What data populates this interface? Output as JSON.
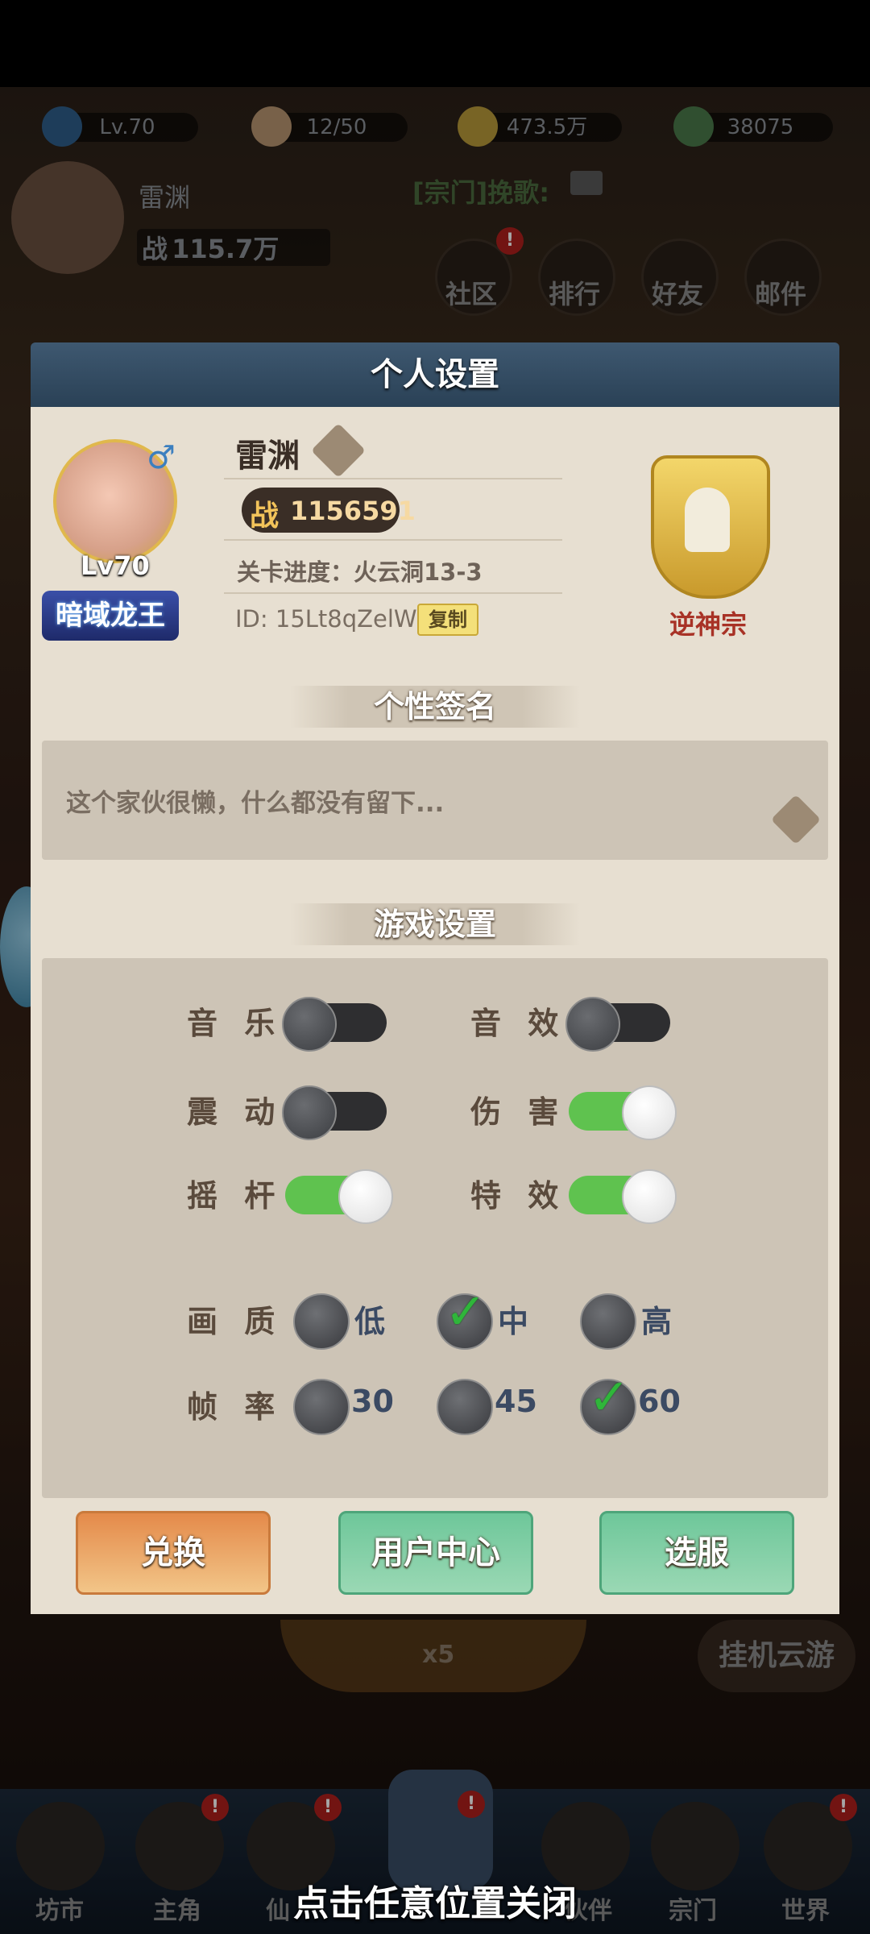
{
  "top_bar": {
    "level": "Lv.70",
    "stamina": "12/50",
    "coins": "473.5万",
    "gems": "38075",
    "player_name": "雷渊",
    "power_label": "战",
    "power_value": "115.7万",
    "sect_chat": "[宗门]挽歌:",
    "menu": [
      {
        "label": "社区",
        "badge": "!"
      },
      {
        "label": "排行",
        "badge": ""
      },
      {
        "label": "好友",
        "badge": ""
      },
      {
        "label": "邮件",
        "badge": ""
      }
    ]
  },
  "dialog": {
    "title": "个人设置",
    "profile": {
      "name": "雷渊",
      "level": "Lv70",
      "title_badge": "暗域龙王",
      "gender_icon": "♂",
      "power_label": "战",
      "power_value": "1156591",
      "stage_progress": "关卡进度：火云洞13-3",
      "id_text": "ID: 15Lt8qZelW",
      "copy_label": "复制",
      "sect_name": "逆神宗"
    },
    "signature": {
      "heading": "个性签名",
      "text": "这个家伙很懒，什么都没有留下..."
    },
    "game_settings": {
      "heading": "游戏设置",
      "toggles": [
        {
          "label": "音 乐",
          "on": false
        },
        {
          "label": "音 效",
          "on": false
        },
        {
          "label": "震 动",
          "on": false
        },
        {
          "label": "伤 害",
          "on": true
        },
        {
          "label": "摇 杆",
          "on": true
        },
        {
          "label": "特 效",
          "on": true
        }
      ],
      "quality": {
        "label": "画 质",
        "options": [
          "低",
          "中",
          "高"
        ],
        "selected": "中"
      },
      "framerate": {
        "label": "帧 率",
        "options": [
          "30",
          "45",
          "60"
        ],
        "selected": "60"
      }
    },
    "buttons": {
      "redeem": "兑换",
      "user_center": "用户中心",
      "server_select": "选服"
    }
  },
  "background": {
    "afk_label": "挂机云游",
    "reward_count": "x5"
  },
  "bottom_nav": [
    "坊市",
    "主角",
    "仙",
    "伙伴",
    "宗门",
    "世界"
  ],
  "close_hint": "点击任意位置关闭"
}
